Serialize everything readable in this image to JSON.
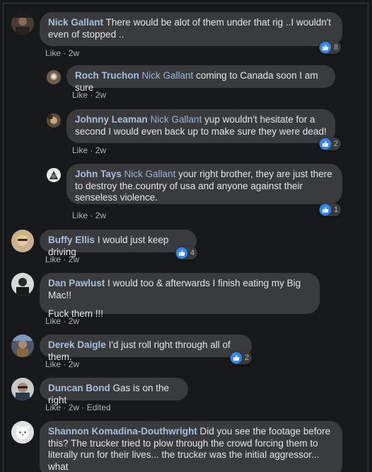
{
  "comments": [
    {
      "author": "Nick Gallant",
      "mention": "",
      "text": "There would be alot of them under that rig ..I wouldn't even of stopped ..",
      "like": "Like",
      "time": "2w",
      "edited": "",
      "reactions": "8"
    },
    {
      "author": "Roch Truchon",
      "mention": "Nick Gallant",
      "text": "coming to Canada soon I am sure",
      "like": "Like",
      "time": "2w",
      "edited": "",
      "reactions": ""
    },
    {
      "author": "Johnny Leaman",
      "mention": "Nick Gallant",
      "text": "yup wouldn't hesitate for a second I would even back up to make sure they were dead!",
      "like": "Like",
      "time": "2w",
      "edited": "",
      "reactions": "2"
    },
    {
      "author": "John Tays",
      "mention": "Nick Gallant",
      "text": "your right brother, they are just there to destroy the.country of usa and anyone against their senseless violence.",
      "like": "Like",
      "time": "2w",
      "edited": "",
      "reactions": "1"
    },
    {
      "author": "Buffy Ellis",
      "mention": "",
      "text": "I would just keep driving",
      "like": "Like",
      "time": "2w",
      "edited": "",
      "reactions": "4"
    },
    {
      "author": "Dan Pawlust",
      "mention": "",
      "text": "I would too & afterwards I finish eating my Big Mac!!",
      "text2": "Fuck them !!!",
      "like": "Like",
      "time": "2w",
      "edited": "",
      "reactions": ""
    },
    {
      "author": "Derek Daigle",
      "mention": "",
      "text": "I'd just roll right through all of them.",
      "like": "Like",
      "time": "2w",
      "edited": "",
      "reactions": "2"
    },
    {
      "author": "Duncan Bond",
      "mention": "",
      "text": "Gas is on the right",
      "like": "Like",
      "time": "2w",
      "edited": "Edited",
      "reactions": ""
    },
    {
      "author": "Shannon Komadina-Douthwright",
      "mention": "",
      "text": "Did you see the footage before this? The trucker tried to plow through the crowd forcing them to literally run for their lives... the trucker was the initial aggressor... what",
      "like": "",
      "time": "",
      "edited": "",
      "reactions": ""
    }
  ],
  "separator": " · ",
  "colors": {
    "background": "#18191a",
    "bubble": "#3a3b3c",
    "link": "#a8c0e0",
    "meta": "#b0b3b8",
    "like_blue": "#2d88ff"
  },
  "icons": {
    "reaction": "thumbs-up-icon"
  }
}
